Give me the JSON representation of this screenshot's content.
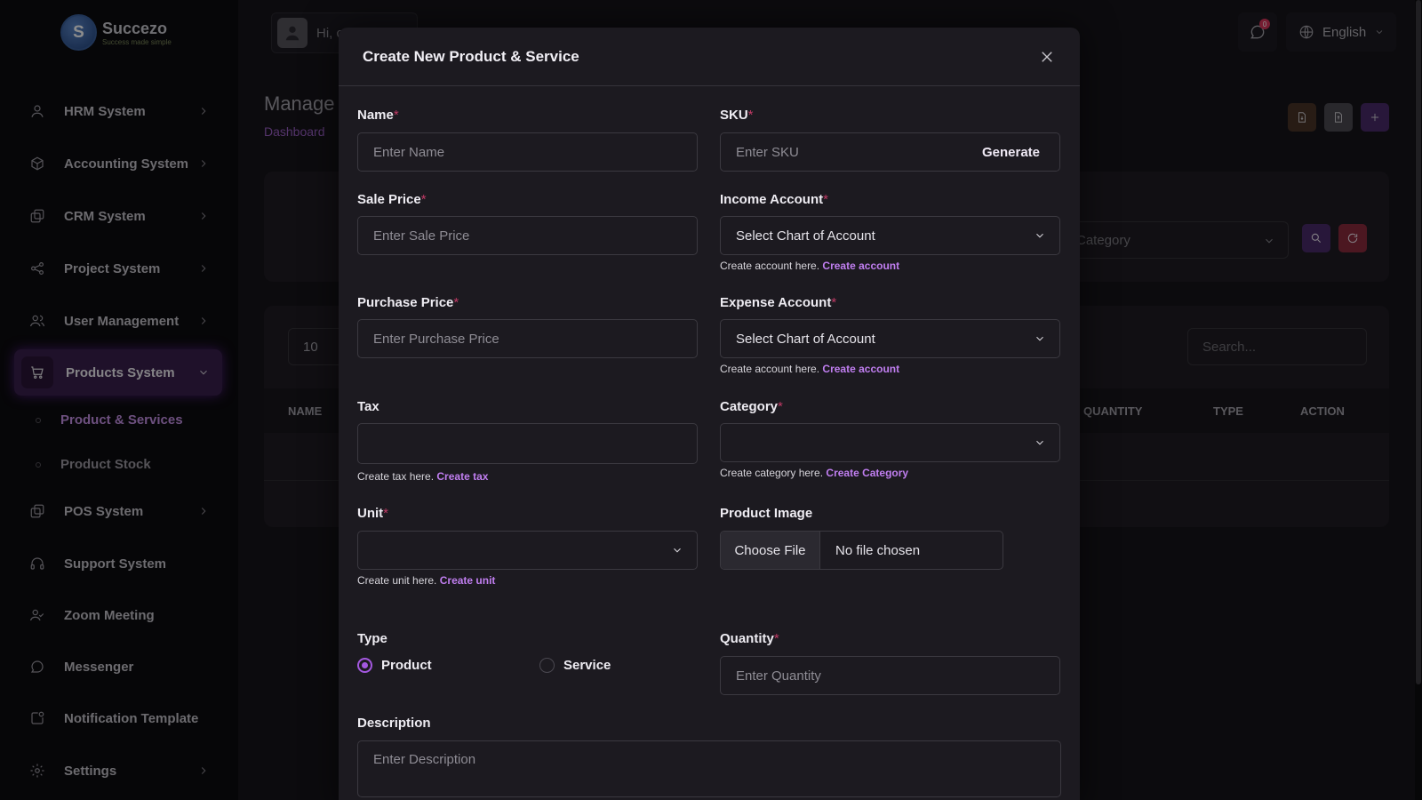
{
  "brand": {
    "logo_letter": "S",
    "name": "Succezo",
    "tagline": "Success made simple"
  },
  "topbar": {
    "greeting": "Hi, c",
    "notification_count": "0",
    "language": "English"
  },
  "sidebar": {
    "items": [
      {
        "label": "HRM System"
      },
      {
        "label": "Accounting System"
      },
      {
        "label": "CRM System"
      },
      {
        "label": "Project System"
      },
      {
        "label": "User Management"
      },
      {
        "label": "Products System"
      },
      {
        "label": "POS System"
      },
      {
        "label": "Support System"
      },
      {
        "label": "Zoom Meeting"
      },
      {
        "label": "Messenger"
      },
      {
        "label": "Notification Template"
      },
      {
        "label": "Settings"
      }
    ],
    "sub_items": [
      {
        "label": "Product & Services"
      },
      {
        "label": "Product Stock"
      }
    ]
  },
  "page": {
    "title": "Manage",
    "breadcrumb": "Dashboard",
    "category_filter": "Category",
    "per_page": "10",
    "search_placeholder": "Search...",
    "columns": [
      "NAME",
      "QUANTITY",
      "TYPE",
      "ACTION"
    ]
  },
  "modal": {
    "title": "Create New Product & Service",
    "name": {
      "label": "Name",
      "placeholder": "Enter Name"
    },
    "sku": {
      "label": "SKU",
      "placeholder": "Enter SKU",
      "button": "Generate"
    },
    "sale_price": {
      "label": "Sale Price",
      "placeholder": "Enter Sale Price"
    },
    "income_account": {
      "label": "Income Account",
      "value": "Select Chart of Account",
      "help": "Create account here.",
      "link": "Create account"
    },
    "purchase_price": {
      "label": "Purchase Price",
      "placeholder": "Enter Purchase Price"
    },
    "expense_account": {
      "label": "Expense Account",
      "value": "Select Chart of Account",
      "help": "Create account here.",
      "link": "Create account"
    },
    "tax": {
      "label": "Tax",
      "help": "Create tax here.",
      "link": "Create tax"
    },
    "category": {
      "label": "Category",
      "help": "Create category here.",
      "link": "Create Category"
    },
    "unit": {
      "label": "Unit",
      "help": "Create unit here.",
      "link": "Create unit"
    },
    "product_image": {
      "label": "Product Image",
      "button": "Choose File",
      "status": "No file chosen"
    },
    "type": {
      "label": "Type",
      "options": [
        "Product",
        "Service"
      ],
      "selected": "Product"
    },
    "quantity": {
      "label": "Quantity",
      "placeholder": "Enter Quantity"
    },
    "description": {
      "label": "Description",
      "placeholder": "Enter Description"
    }
  },
  "colors": {
    "accent": "#a458e0",
    "required": "#c03a65",
    "link": "#c07ef0",
    "sidebar_active": "#3a1f4d"
  }
}
